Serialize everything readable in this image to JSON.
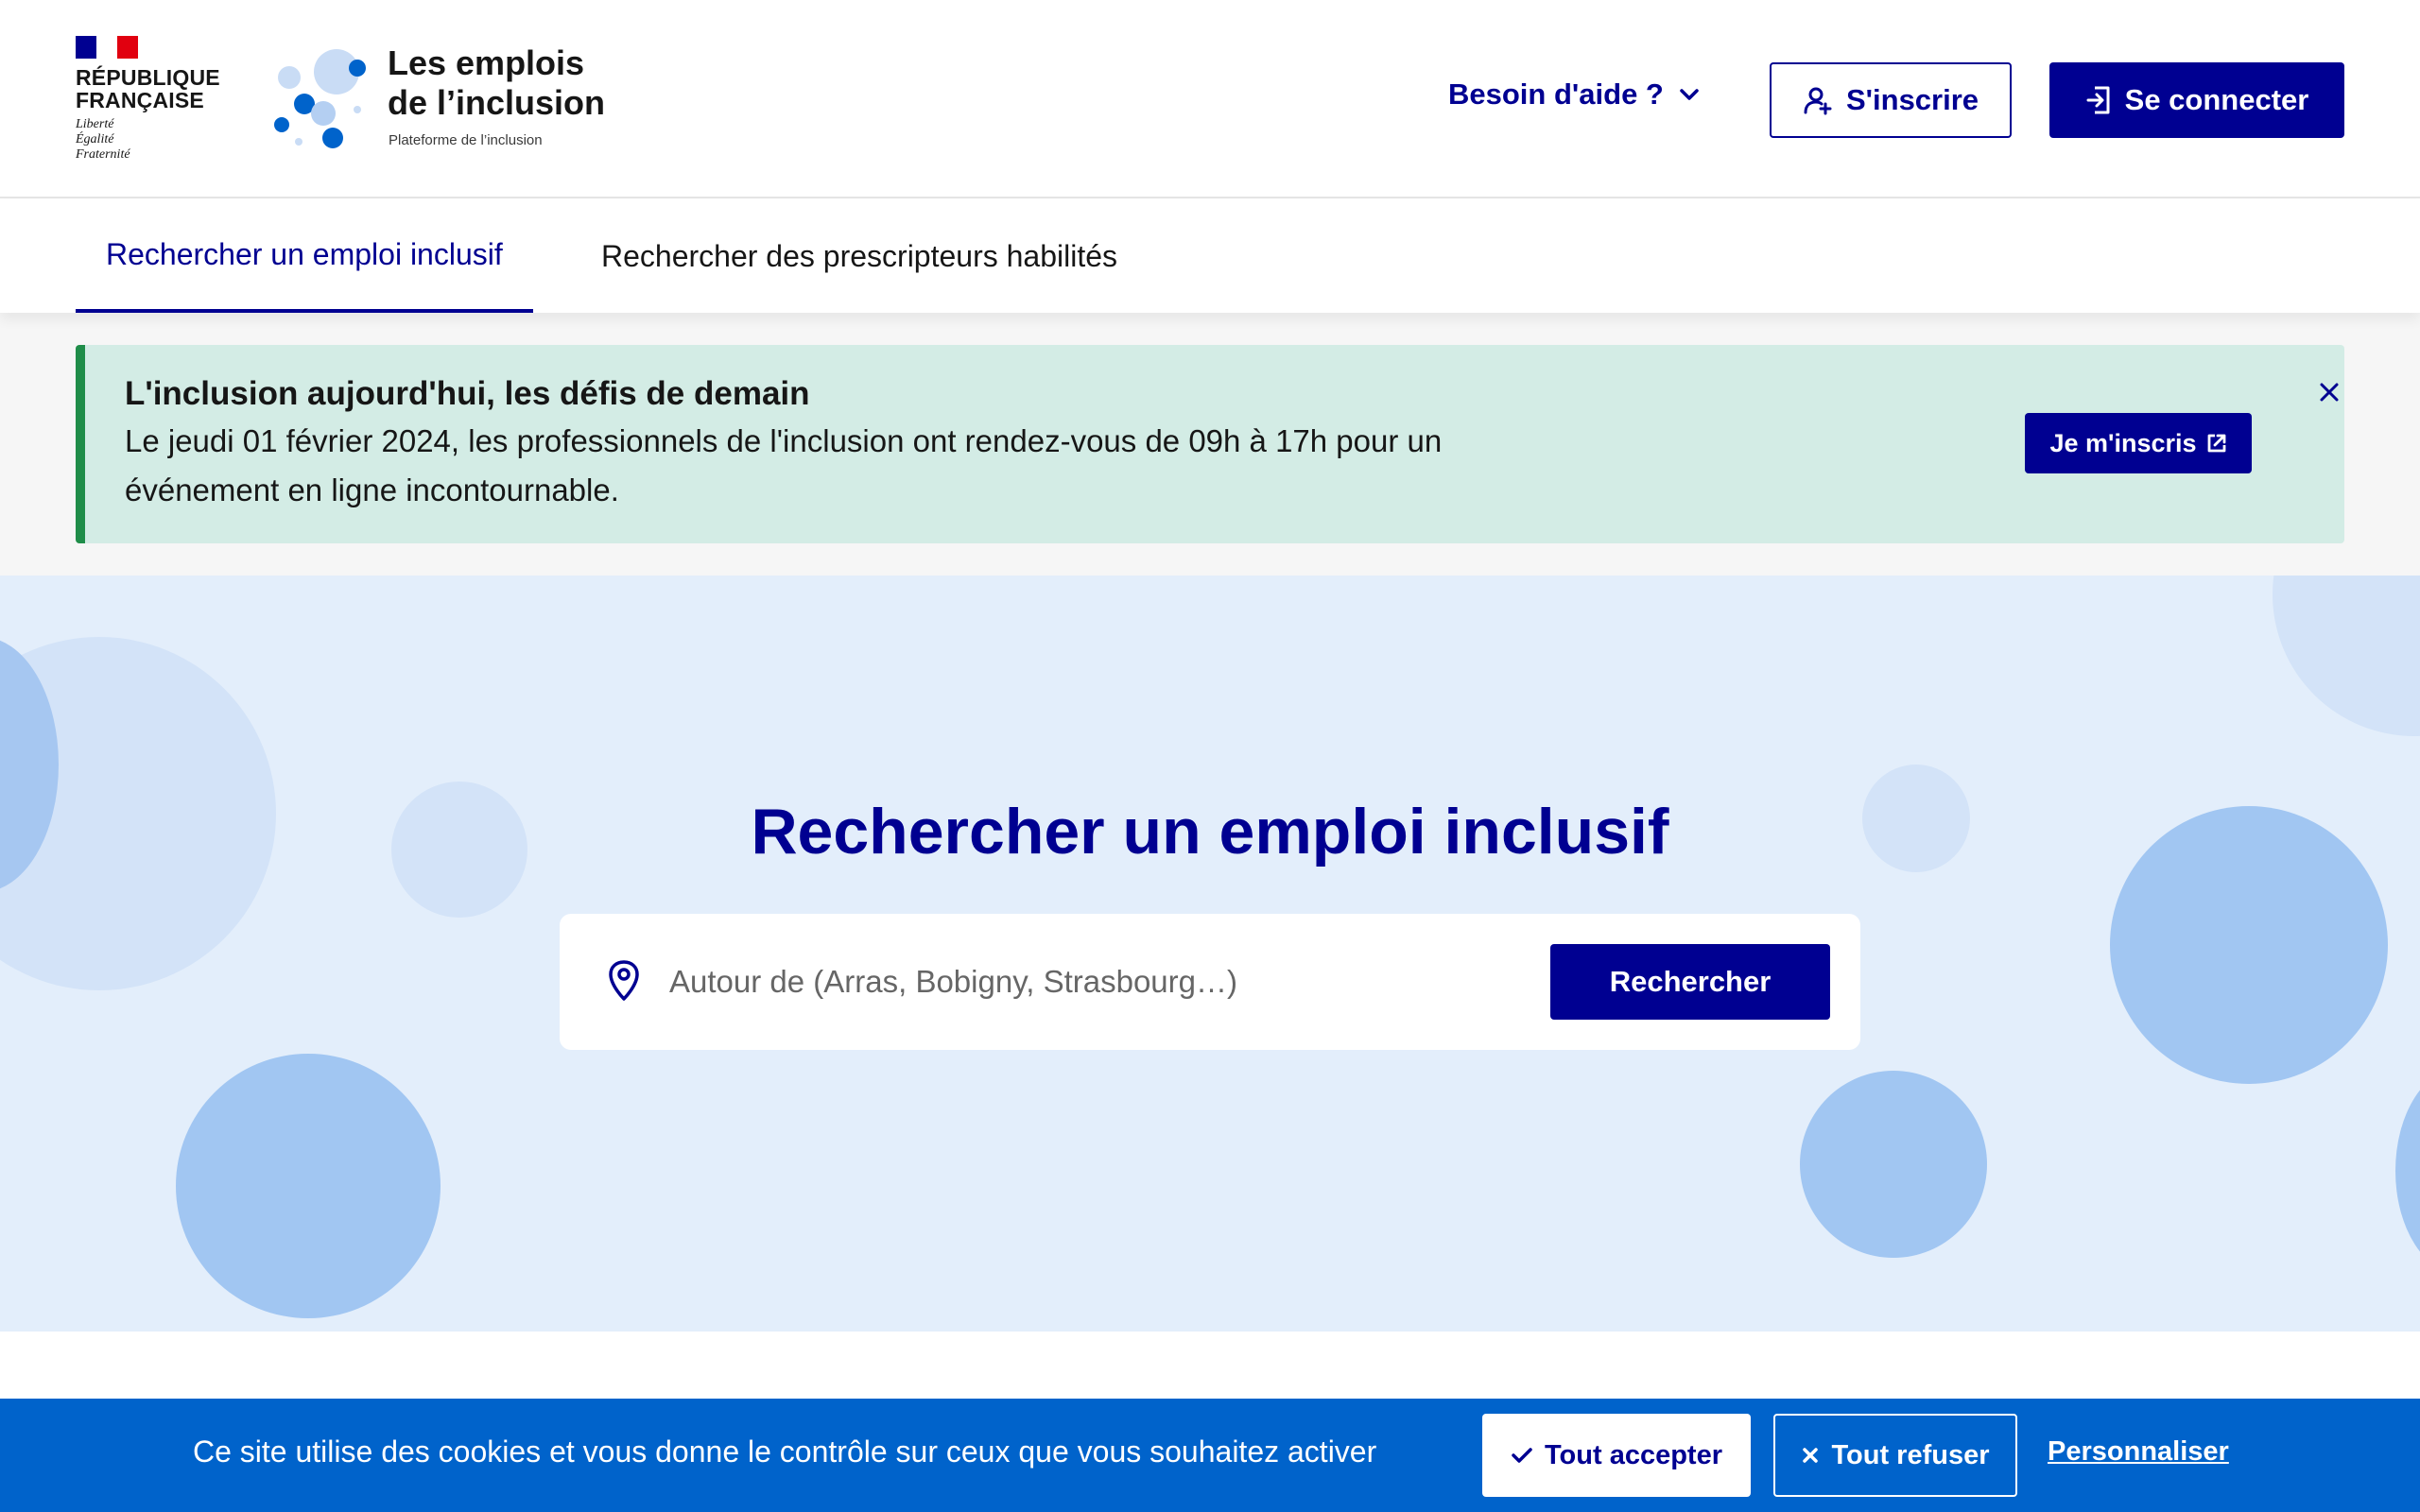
{
  "header": {
    "republic_line1": "RÉPUBLIQUE",
    "republic_line2": "FRANÇAISE",
    "motto": [
      "Liberté",
      "Égalité",
      "Fraternité"
    ],
    "service_title_line1": "Les emplois",
    "service_title_line2": "de l’inclusion",
    "service_tagline": "Plateforme de l’inclusion",
    "help_label": "Besoin d'aide ?",
    "signup_label": "S'inscrire",
    "login_label": "Se connecter"
  },
  "nav": {
    "tabs": [
      {
        "label": "Rechercher un emploi inclusif",
        "active": true
      },
      {
        "label": "Rechercher des prescripteurs habilités",
        "active": false
      }
    ]
  },
  "notice": {
    "title": "L'inclusion aujourd'hui, les défis de demain",
    "text": "Le jeudi 01 février 2024, les professionnels de l'inclusion ont rendez-vous de 09h à 17h pour un événement en ligne incontournable.",
    "button_label": "Je m'inscris"
  },
  "hero": {
    "title": "Rechercher un emploi inclusif",
    "search_placeholder": "Autour de (Arras, Bobigny, Strasbourg…)",
    "search_button": "Rechercher"
  },
  "cookie": {
    "text": "Ce site utilise des cookies et vous donne le contrôle sur ceux que vous souhaitez activer",
    "accept_label": "Tout accepter",
    "refuse_label": "Tout refuser",
    "customize_label": "Personnaliser"
  },
  "colors": {
    "brand_blue": "#000091",
    "flag_blue": "#000091",
    "flag_red": "#e1000f",
    "notice_bg": "#d3ece5",
    "notice_accent": "#1f8d49",
    "hero_bg": "#e3eefb",
    "cookie_bg": "#0063cb"
  }
}
